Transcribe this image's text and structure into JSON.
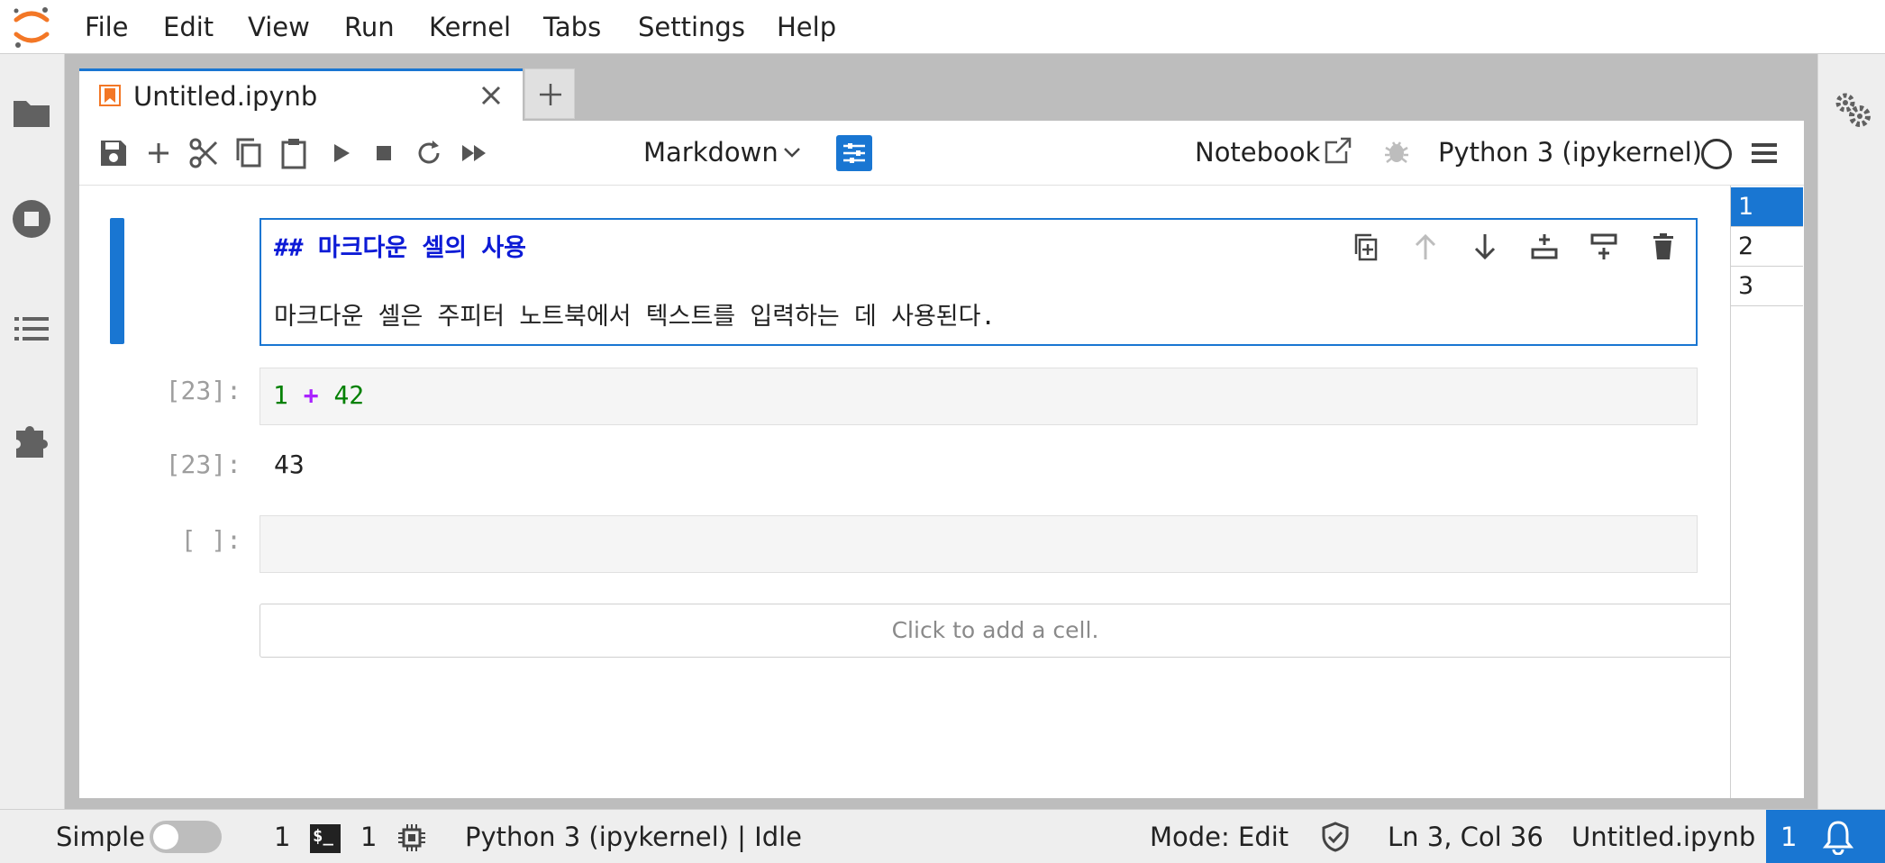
{
  "menubar": {
    "items": [
      "File",
      "Edit",
      "View",
      "Run",
      "Kernel",
      "Tabs",
      "Settings",
      "Help"
    ]
  },
  "left_sidebar": {
    "icons": [
      "folder-icon",
      "running-icon",
      "table-of-contents-icon",
      "extensions-icon"
    ]
  },
  "right_sidebar": {
    "icons": [
      "property-inspector-gears-icon"
    ]
  },
  "tab": {
    "title": "Untitled.ipynb",
    "add_label": "+"
  },
  "toolbar": {
    "cell_type": "Markdown",
    "notebook_label": "Notebook",
    "kernel_name": "Python 3 (ipykernel)"
  },
  "toc": {
    "items": [
      "1",
      "2",
      "3"
    ],
    "active_index": 0
  },
  "cells": {
    "markdown": {
      "line1": "## 마크다운 셀의 사용",
      "line3": "마크다운 셀은 주피터 노트북에서 텍스트를 입력하는 데 사용된다."
    },
    "code": {
      "prompt": "[23]:",
      "tokens": [
        "1",
        "+",
        "42"
      ],
      "output_prompt": "[23]:",
      "output": "43"
    },
    "empty": {
      "prompt": "[ ]:"
    },
    "add_cell_label": "Click to add a cell."
  },
  "statusbar": {
    "simple_label": "Simple",
    "terminals_count": "1",
    "kernels_count": "1",
    "kernel_status": "Python 3 (ipykernel) | Idle",
    "mode": "Mode: Edit",
    "cursor": "Ln 3, Col 36",
    "filename": "Untitled.ipynb",
    "notifications": "1"
  },
  "colors": {
    "accent": "#1976d2",
    "logo_orange": "#f37726",
    "markdown_heading": "#0d1bd6",
    "number": "#008000",
    "operator": "#aa22ff"
  }
}
